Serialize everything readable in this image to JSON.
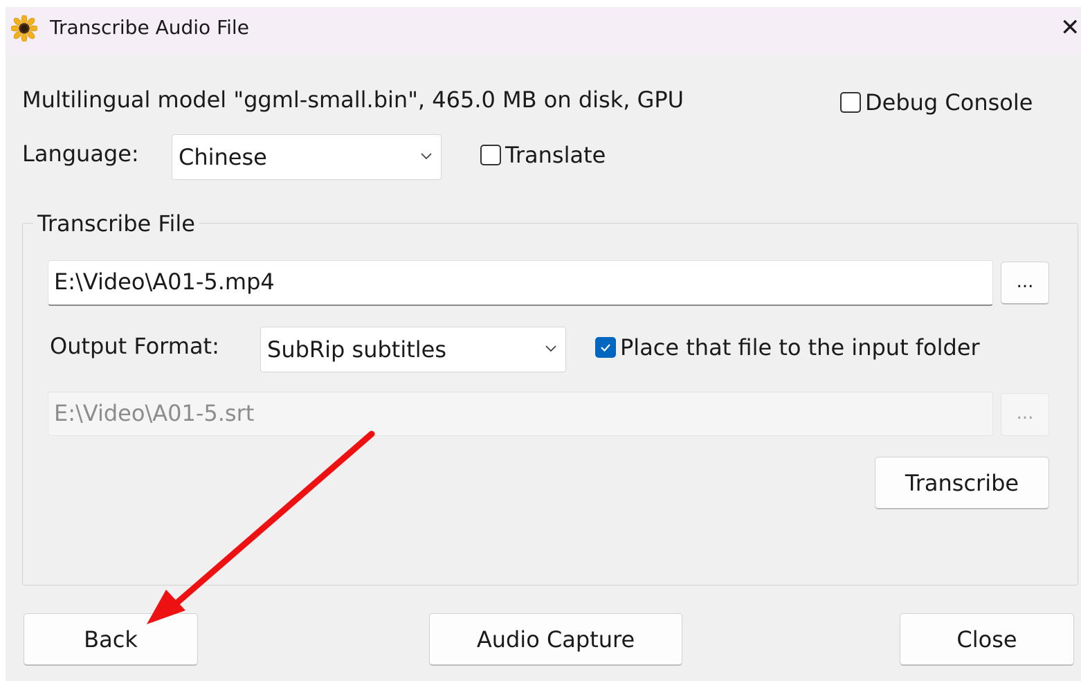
{
  "window": {
    "title": "Transcribe Audio File",
    "close_icon": "close-icon",
    "app_icon": "sunflower-icon"
  },
  "model_info": "Multilingual model \"ggml-small.bin\", 465.0 MB on disk, GPU",
  "debug_console": {
    "label": "Debug Console",
    "checked": false
  },
  "language": {
    "label": "Language:",
    "value": "Chinese"
  },
  "translate": {
    "label": "Translate",
    "checked": false
  },
  "transcribe_file": {
    "group_title": "Transcribe File",
    "input_path": "E:\\Video\\A01-5.mp4",
    "browse_label": "...",
    "output_format_label": "Output Format:",
    "output_format_value": "SubRip subtitles",
    "place_in_input_folder": {
      "label": "Place that file to the input folder",
      "checked": true
    },
    "output_path": "E:\\Video\\A01-5.srt",
    "output_browse_label": "...",
    "transcribe_button": "Transcribe"
  },
  "footer": {
    "back_button": "Back",
    "audio_capture_button": "Audio Capture",
    "close_button": "Close"
  },
  "annotation": {
    "arrow_color": "#ee1111"
  },
  "colors": {
    "accent": "#0067c0"
  }
}
